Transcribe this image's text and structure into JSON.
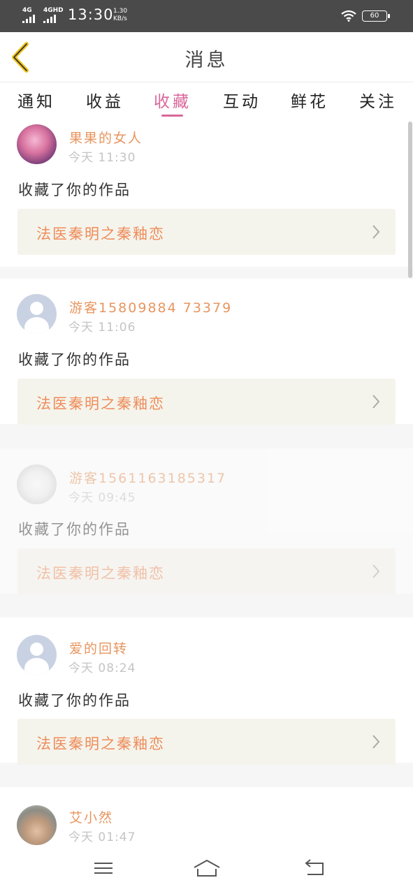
{
  "status_bar": {
    "network1": "4G",
    "network2": "4GHD",
    "time": "13:30",
    "speed_value": "1.30",
    "speed_unit": "KB/s",
    "battery": "60"
  },
  "header": {
    "title": "消息",
    "back_icon": "chevron-left-icon"
  },
  "tabs": [
    {
      "label": "通知",
      "active": false
    },
    {
      "label": "收益",
      "active": false
    },
    {
      "label": "收藏",
      "active": true
    },
    {
      "label": "互动",
      "active": false
    },
    {
      "label": "鲜花",
      "active": false
    },
    {
      "label": "关注",
      "active": false
    }
  ],
  "colors": {
    "accent": "#d9679b",
    "username": "#e8955e",
    "work_title": "#ee8c5a",
    "work_box_bg": "#f5f4ec"
  },
  "messages": [
    {
      "username": "果果的女人",
      "time": "今天 11:30",
      "action": "收藏了你的作品",
      "work_title": "法医秦明之秦釉恋",
      "avatar": "photo-girl"
    },
    {
      "username": "游客15809884 73379",
      "time": "今天 11:06",
      "action": "收藏了你的作品",
      "work_title": "法医秦明之秦釉恋",
      "avatar": "default-user"
    },
    {
      "username": "游客1561163185317",
      "time": "今天 09:45",
      "action": "收藏了你的作品",
      "work_title": "法医秦明之秦釉恋",
      "avatar": "photo-cat"
    },
    {
      "username": "爱的回转",
      "time": "今天 08:24",
      "action": "收藏了你的作品",
      "work_title": "法医秦明之秦釉恋",
      "avatar": "default-user"
    },
    {
      "username": "艾小然",
      "time": "今天 01:47",
      "avatar": "photo-hand"
    }
  ],
  "bottom_nav": [
    "menu-icon",
    "home-icon",
    "back-icon"
  ]
}
